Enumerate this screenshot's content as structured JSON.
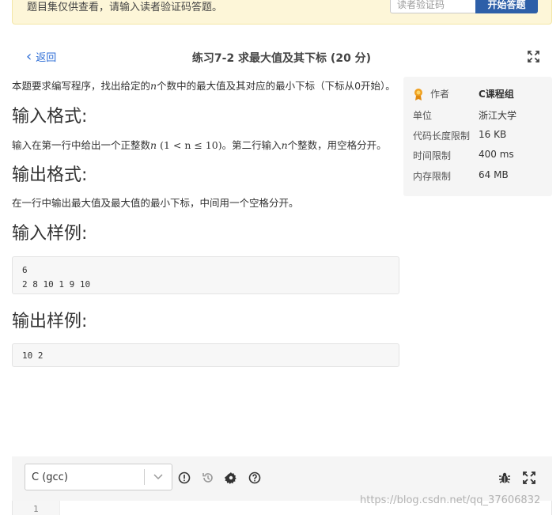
{
  "banner": {
    "message": "题目集仅供查看，请输入读者验证码答题。",
    "code_placeholder": "读者验证码",
    "start_label": "开始答题"
  },
  "header": {
    "back_label": "返回",
    "title": "练习7-2 求最大值及其下标 (20 分)"
  },
  "problem": {
    "intro_pre": "本题要求编写程序，找出给定的",
    "intro_var": "n",
    "intro_post": "个数中的最大值及其对应的最小下标（下标从0开始）。",
    "input_heading": "输入格式:",
    "input_pre": "输入在第一行中给出一个正整数",
    "input_var": "n",
    "input_math": "(1 < n ≤ 10)",
    "input_mid": "。第二行输入",
    "input_var2": "n",
    "input_post": "个整数，用空格分开。",
    "output_heading": "输出格式:",
    "output_text": "在一行中输出最大值及最大值的最小下标，中间用一个空格分开。",
    "sample_in_heading": "输入样例:",
    "sample_in": "6\n2 8 10 1 9 10",
    "sample_out_heading": "输出样例:",
    "sample_out": "10 2"
  },
  "info": {
    "author_label": "作者",
    "author": "C课程组",
    "unit_label": "单位",
    "unit": "浙江大学",
    "code_len_label": "代码长度限制",
    "code_len": "16 KB",
    "time_label": "时间限制",
    "time": "400 ms",
    "mem_label": "内存限制",
    "mem": "64 MB"
  },
  "editor": {
    "language": "C (gcc)",
    "line1": "1"
  },
  "watermark": "https://blog.csdn.net/qq_37606832",
  "colors": {
    "accent": "#2a6bd6",
    "button": "#2d5fa8",
    "banner": "#fdf6d8"
  }
}
